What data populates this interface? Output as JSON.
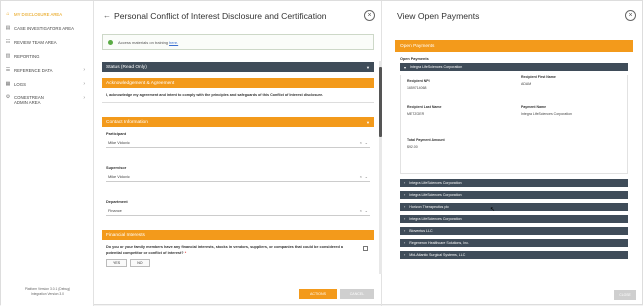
{
  "sidebar": {
    "items": [
      {
        "label": "My Disclosure Area",
        "icon": "home-icon",
        "active": true,
        "chevron": false
      },
      {
        "label": "Case Investigators Area",
        "icon": "case-icon",
        "active": false,
        "chevron": false
      },
      {
        "label": "Review Team Area",
        "icon": "review-icon",
        "active": false,
        "chevron": false
      },
      {
        "label": "Reporting",
        "icon": "chart-icon",
        "active": false,
        "chevron": false
      },
      {
        "label": "Reference Data",
        "icon": "database-icon",
        "active": false,
        "chevron": true
      },
      {
        "label": "Logs",
        "icon": "logs-icon",
        "active": false,
        "chevron": true
      },
      {
        "label": "Conestrean Admin Area",
        "icon": "admin-icon",
        "active": false,
        "chevron": true
      }
    ],
    "footer_line1": "Platform Version 3.0.1 (Debug)",
    "footer_line2": "Integration Version 3.0"
  },
  "left": {
    "title": "Personal Conflict of Interest Disclosure and Certification",
    "notice_text": "Access materials on training",
    "notice_link": "here.",
    "status_section": "Status (Read Only)",
    "ack_section": "Acknowledgement & Agreement",
    "ack_text": "I, acknowledge my agreement and intent to comply with the principles and safeguards of this Conflict of Interest disclosure.",
    "contact_section": "Contact Information",
    "participant_label": "Participant",
    "participant_value": "Mike Vidovic",
    "supervisor_label": "Supervisor",
    "supervisor_value": "Mike Vidovic",
    "department_label": "Department",
    "department_value": "Finance",
    "financial_section": "Financial Interests",
    "question": "Do you or your family members have any financial interests, stocks in vendors, suppliers, or companies that could be considered a potential competitor or conflict of interest?",
    "question_req": "*",
    "yes_label": "YES",
    "no_label": "NO",
    "actions_label": "Actions",
    "cancel_label": "Cancel"
  },
  "right": {
    "title": "View Open Payments",
    "section": "Open Payments",
    "sub": "Open Payments",
    "open_item": "Integra LifeSciences Corporation",
    "fields": {
      "npi_label": "Recipient NPI",
      "npi_value": "1659714068",
      "first_label": "Recipient First Name",
      "first_value": "ADAM",
      "last_label": "Recipient Last Name",
      "last_value": "METZGER",
      "payer_label": "Payment Name",
      "payer_value": "Integra LifeSciences Corporation",
      "total_label": "Total Payment Amount",
      "total_value": "$92.00"
    },
    "collapsed_items": [
      "Integra LifeSciences Corporation",
      "Integra LifeSciences Corporation",
      "Horizon Therapeutics plc",
      "Integra LifeSciences Corporation",
      "Bioventus LLC",
      "Regeneron Healthcare Solutions, Inc.",
      "Mid-Atlantic Surgical Systems, LLC"
    ],
    "close_label": "Close"
  }
}
